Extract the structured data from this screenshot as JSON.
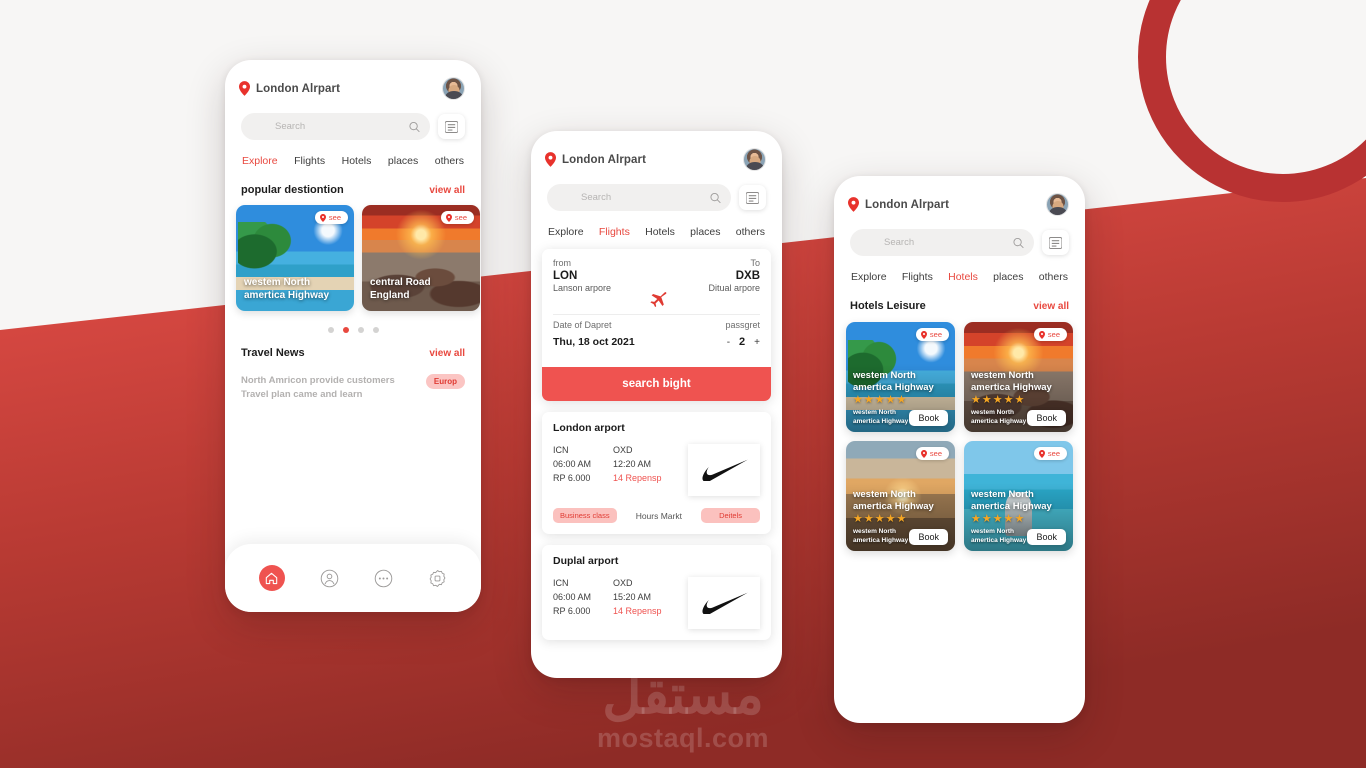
{
  "background": {
    "base_color": "#f7f6f5",
    "accent_red": "#c23a33",
    "bright_red": "#e8483f",
    "ring_color": "#b83232"
  },
  "watermark": {
    "arabic": "مستقل",
    "latin": "mostaql.com"
  },
  "common": {
    "location": "London Alrpart",
    "search_placeholder": "Search",
    "icons": {
      "pin": "location-pin-icon",
      "search": "search-icon",
      "filter": "filter-icon",
      "avatar": "user-avatar"
    }
  },
  "phone1": {
    "tabs": [
      {
        "label": "Explore",
        "active": true
      },
      {
        "label": "Flights",
        "active": false
      },
      {
        "label": "Hotels",
        "active": false
      },
      {
        "label": "places",
        "active": false
      },
      {
        "label": "others",
        "active": false
      }
    ],
    "section": {
      "title": "popular destiontion",
      "view_all": "view all"
    },
    "destinations": [
      {
        "title": "westem North amertica Highway",
        "badge": "see",
        "image": "beach-island"
      },
      {
        "title": "central Road England",
        "badge": "see",
        "image": "sunset-rocks"
      }
    ],
    "pagination": {
      "count": 4,
      "active_index": 1
    },
    "news": {
      "title": "Travel News",
      "view_all": "view all",
      "headline": "North Amricon provide customers Travel plan came and learn",
      "tag": "Europ"
    },
    "bottom_nav": [
      {
        "name": "home-icon",
        "active": true
      },
      {
        "name": "profile-icon",
        "active": false
      },
      {
        "name": "more-icon",
        "active": false
      },
      {
        "name": "settings-gear-icon",
        "active": false
      }
    ]
  },
  "phone2": {
    "tabs": [
      {
        "label": "Explore",
        "active": false
      },
      {
        "label": "Flights",
        "active": true
      },
      {
        "label": "Hotels",
        "active": false
      },
      {
        "label": "places",
        "active": false
      },
      {
        "label": "others",
        "active": false
      }
    ],
    "search_form": {
      "from_label": "from",
      "to_label": "To",
      "from_code": "LON",
      "to_code": "DXB",
      "from_airport": "Lanson arpore",
      "to_airport": "Ditual arpore",
      "date_label": "Date of Dapret",
      "passenger_label": "passgret",
      "date_value": "Thu, 18 oct 2021",
      "minus": "-",
      "passenger_count": "2",
      "plus": "+",
      "submit": "search bight"
    },
    "results": [
      {
        "title": "London arport",
        "origin_code": "ICN",
        "origin_time": "06:00 AM",
        "price": "RP 6.000",
        "dest_code": "OXD",
        "dest_time": "12:20 AM",
        "duration": "14 Repensp",
        "class_pill": "Business class",
        "mid_label": "Hours Markt",
        "details_pill": "Deitels",
        "airline_logo": "nike-swoosh-icon"
      },
      {
        "title": "Duplal arport",
        "origin_code": "ICN",
        "origin_time": "06:00 AM",
        "price": "RP 6.000",
        "dest_code": "OXD",
        "dest_time": "15:20 AM",
        "duration": "14 Repensp",
        "class_pill": "",
        "mid_label": "",
        "details_pill": "",
        "airline_logo": "nike-swoosh-icon"
      }
    ]
  },
  "phone3": {
    "tabs": [
      {
        "label": "Explore",
        "active": false
      },
      {
        "label": "Flights",
        "active": false
      },
      {
        "label": "Hotels",
        "active": true
      },
      {
        "label": "places",
        "active": false
      },
      {
        "label": "others",
        "active": false
      }
    ],
    "section": {
      "title": "Hotels Leisure",
      "view_all": "view all"
    },
    "hotels": [
      {
        "title": "westem North amertica Highway",
        "badge": "see",
        "stars": 5,
        "subtitle": "westem North amertica Highway",
        "book": "Book",
        "image": "beach-island"
      },
      {
        "title": "westem North amertica Highway",
        "badge": "see",
        "stars": 5,
        "subtitle": "westem North amertica Highway",
        "book": "Book",
        "image": "sunset-rocks"
      },
      {
        "title": "westem North amertica Highway",
        "badge": "see",
        "stars": 5,
        "subtitle": "westem North amertica Highway",
        "book": "Book",
        "image": "dusk-beach"
      },
      {
        "title": "westem North amertica Highway",
        "badge": "see",
        "stars": 5,
        "subtitle": "westem North amertica Highway",
        "book": "Book",
        "image": "turquoise-boat"
      }
    ]
  }
}
